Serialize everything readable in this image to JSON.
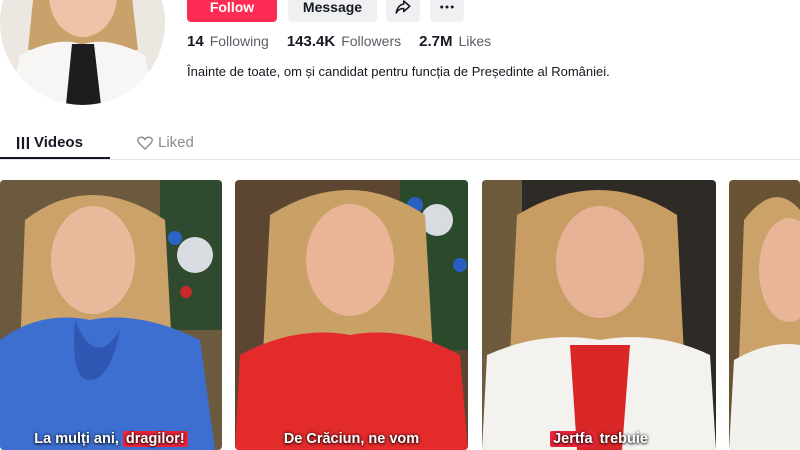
{
  "profile": {
    "avatar_icon": "profile-avatar",
    "bio": "Înainte de toate, om și candidat pentru funcția de Președinte al României."
  },
  "actions": {
    "follow_label": "Follow",
    "message_label": "Message",
    "share_icon": "share-arrow-icon",
    "more_icon": "more-dots-icon"
  },
  "stats": {
    "following": {
      "count": "14",
      "label": "Following"
    },
    "followers": {
      "count": "143.4K",
      "label": "Followers"
    },
    "likes": {
      "count": "2.7M",
      "label": "Likes"
    }
  },
  "tabs": [
    {
      "label": "Videos",
      "icon": "grid-icon",
      "active": true
    },
    {
      "label": "Liked",
      "icon": "heart-lock-icon",
      "active": false
    }
  ],
  "videos": [
    {
      "caption_pre": "La mulți ani, ",
      "caption_hl": "dragilor!",
      "caption_post": ""
    },
    {
      "caption_pre": "De Crăciun, ne vom",
      "caption_hl": "",
      "caption_post": ""
    },
    {
      "caption_pre": "",
      "caption_hl": "Jertfa",
      "caption_post": " trebuie"
    },
    {
      "caption_pre": "",
      "caption_hl": "",
      "caption_post": ""
    }
  ],
  "colors": {
    "accent": "#fe2c55",
    "caption_highlight": "#e8253a"
  }
}
